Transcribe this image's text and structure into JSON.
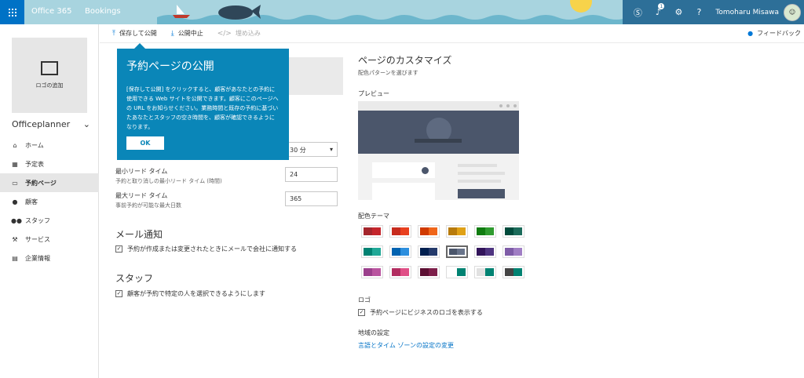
{
  "header": {
    "app1": "Office 365",
    "app2": "Bookings",
    "notif_count": "1",
    "user_name": "Tomoharu Misawa",
    "icons": [
      "skype-icon",
      "bell-icon",
      "gear-icon",
      "help-icon"
    ]
  },
  "sidebar": {
    "logo_label": "ロゴの追加",
    "business_name": "Officeplanner",
    "items": [
      {
        "label": "ホーム",
        "icon": "home-icon"
      },
      {
        "label": "予定表",
        "icon": "calendar-icon"
      },
      {
        "label": "予約ページ",
        "icon": "laptop-icon"
      },
      {
        "label": "顧客",
        "icon": "person-icon"
      },
      {
        "label": "スタッフ",
        "icon": "people-icon"
      },
      {
        "label": "サービス",
        "icon": "wrench-icon"
      },
      {
        "label": "企業情報",
        "icon": "briefcase-icon"
      }
    ]
  },
  "commands": {
    "publish": "保存して公開",
    "unpublish": "公開中止",
    "embed": "埋め込み",
    "feedback": "フィードバック"
  },
  "callout": {
    "title": "予約ページの公開",
    "body": "[保存して公開] をクリックすると、顧客があなたとの予約に使用できる Web サイトを公開できます。顧客にこのページへの URL をお知らせください。業務時間と既存の予約に基づいたあなたとスタッフの空き時間を、顧客が確認できるようになります。",
    "ok": "OK"
  },
  "settings": {
    "interval_value": "30 分",
    "min_lead_label": "最小リード タイム",
    "min_lead_sub": "予約と取り消しの最小リード タイム (時間)",
    "min_lead_value": "24",
    "max_lead_label": "最大リード タイム",
    "max_lead_sub": "事前予約が可能な最大日数",
    "max_lead_value": "365",
    "email_title": "メール通知",
    "email_check": "予約が作成または変更されたときにメールで会社に通知する",
    "staff_title": "スタッフ",
    "staff_check": "顧客が予約で特定の人を選択できるようにします"
  },
  "customize": {
    "title": "ページのカスタマイズ",
    "subtitle": "配色パターンを選びます",
    "preview_label": "プレビュー",
    "theme_label": "配色テーマ",
    "logo_label": "ロゴ",
    "logo_check": "予約ページにビジネスのロゴを表示する",
    "region_label": "地域の設定",
    "region_link": "言語とタイム ゾーンの設定の変更"
  },
  "colors": {
    "accent": "#0072c6",
    "callout": "#0a86b8",
    "themes": [
      [
        "#a4262c",
        "#c4262c"
      ],
      [
        "#c72b1e",
        "#e8401f"
      ],
      [
        "#d03a00",
        "#f0661a"
      ],
      [
        "#b87b0b",
        "#e0a116"
      ],
      [
        "#107c10",
        "#2f9b2f"
      ],
      [
        "#004b3c",
        "#1b6b5a"
      ],
      [
        "#008272",
        "#20a897"
      ],
      [
        "#0063b1",
        "#2d8fde"
      ],
      [
        "#002050",
        "#243a6b"
      ],
      [
        "#4b566b",
        "#68738a"
      ],
      [
        "#32145a",
        "#4e3480"
      ],
      [
        "#7e5ca7",
        "#a07ec4"
      ],
      [
        "#9b3f8c",
        "#b9549f"
      ],
      [
        "#b22d60",
        "#e04f86"
      ],
      [
        "#5c0f33",
        "#7d1f4a"
      ],
      [
        "#ffffff",
        "#008272"
      ],
      [
        "#e1e1e1",
        "#008272"
      ],
      [
        "#444444",
        "#008272"
      ]
    ],
    "selected_theme": 9
  }
}
